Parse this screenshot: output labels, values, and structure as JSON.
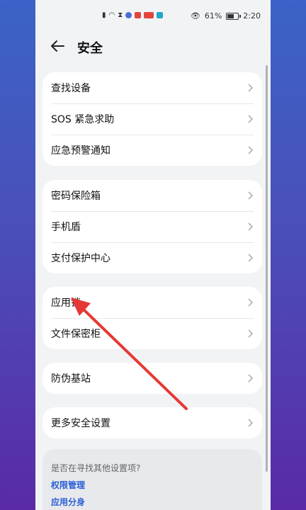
{
  "status_bar": {
    "battery_percent": "61%",
    "time": "2:20",
    "icons": [
      "signal-icon",
      "wifi-icon",
      "hourglass-icon",
      "app-icon",
      "app-icon",
      "app-icon",
      "app-icon",
      "eye-icon",
      "battery-icon"
    ]
  },
  "header": {
    "title": "安全"
  },
  "groups": [
    {
      "items": [
        {
          "label": "查找设备"
        },
        {
          "label": "SOS 紧急求助"
        },
        {
          "label": "应急预警通知"
        }
      ]
    },
    {
      "items": [
        {
          "label": "密码保险箱"
        },
        {
          "label": "手机盾"
        },
        {
          "label": "支付保护中心"
        }
      ]
    },
    {
      "items": [
        {
          "label": "应用锁"
        },
        {
          "label": "文件保密柜"
        }
      ]
    },
    {
      "items": [
        {
          "label": "防伪基站"
        }
      ]
    },
    {
      "items": [
        {
          "label": "更多安全设置"
        }
      ]
    }
  ],
  "suggestions": {
    "question": "是否在寻找其他设置项?",
    "links": [
      {
        "label": "权限管理"
      },
      {
        "label": "应用分身"
      }
    ]
  },
  "colors": {
    "accent_link": "#2a5fd6",
    "annotation_arrow": "#e53935"
  }
}
